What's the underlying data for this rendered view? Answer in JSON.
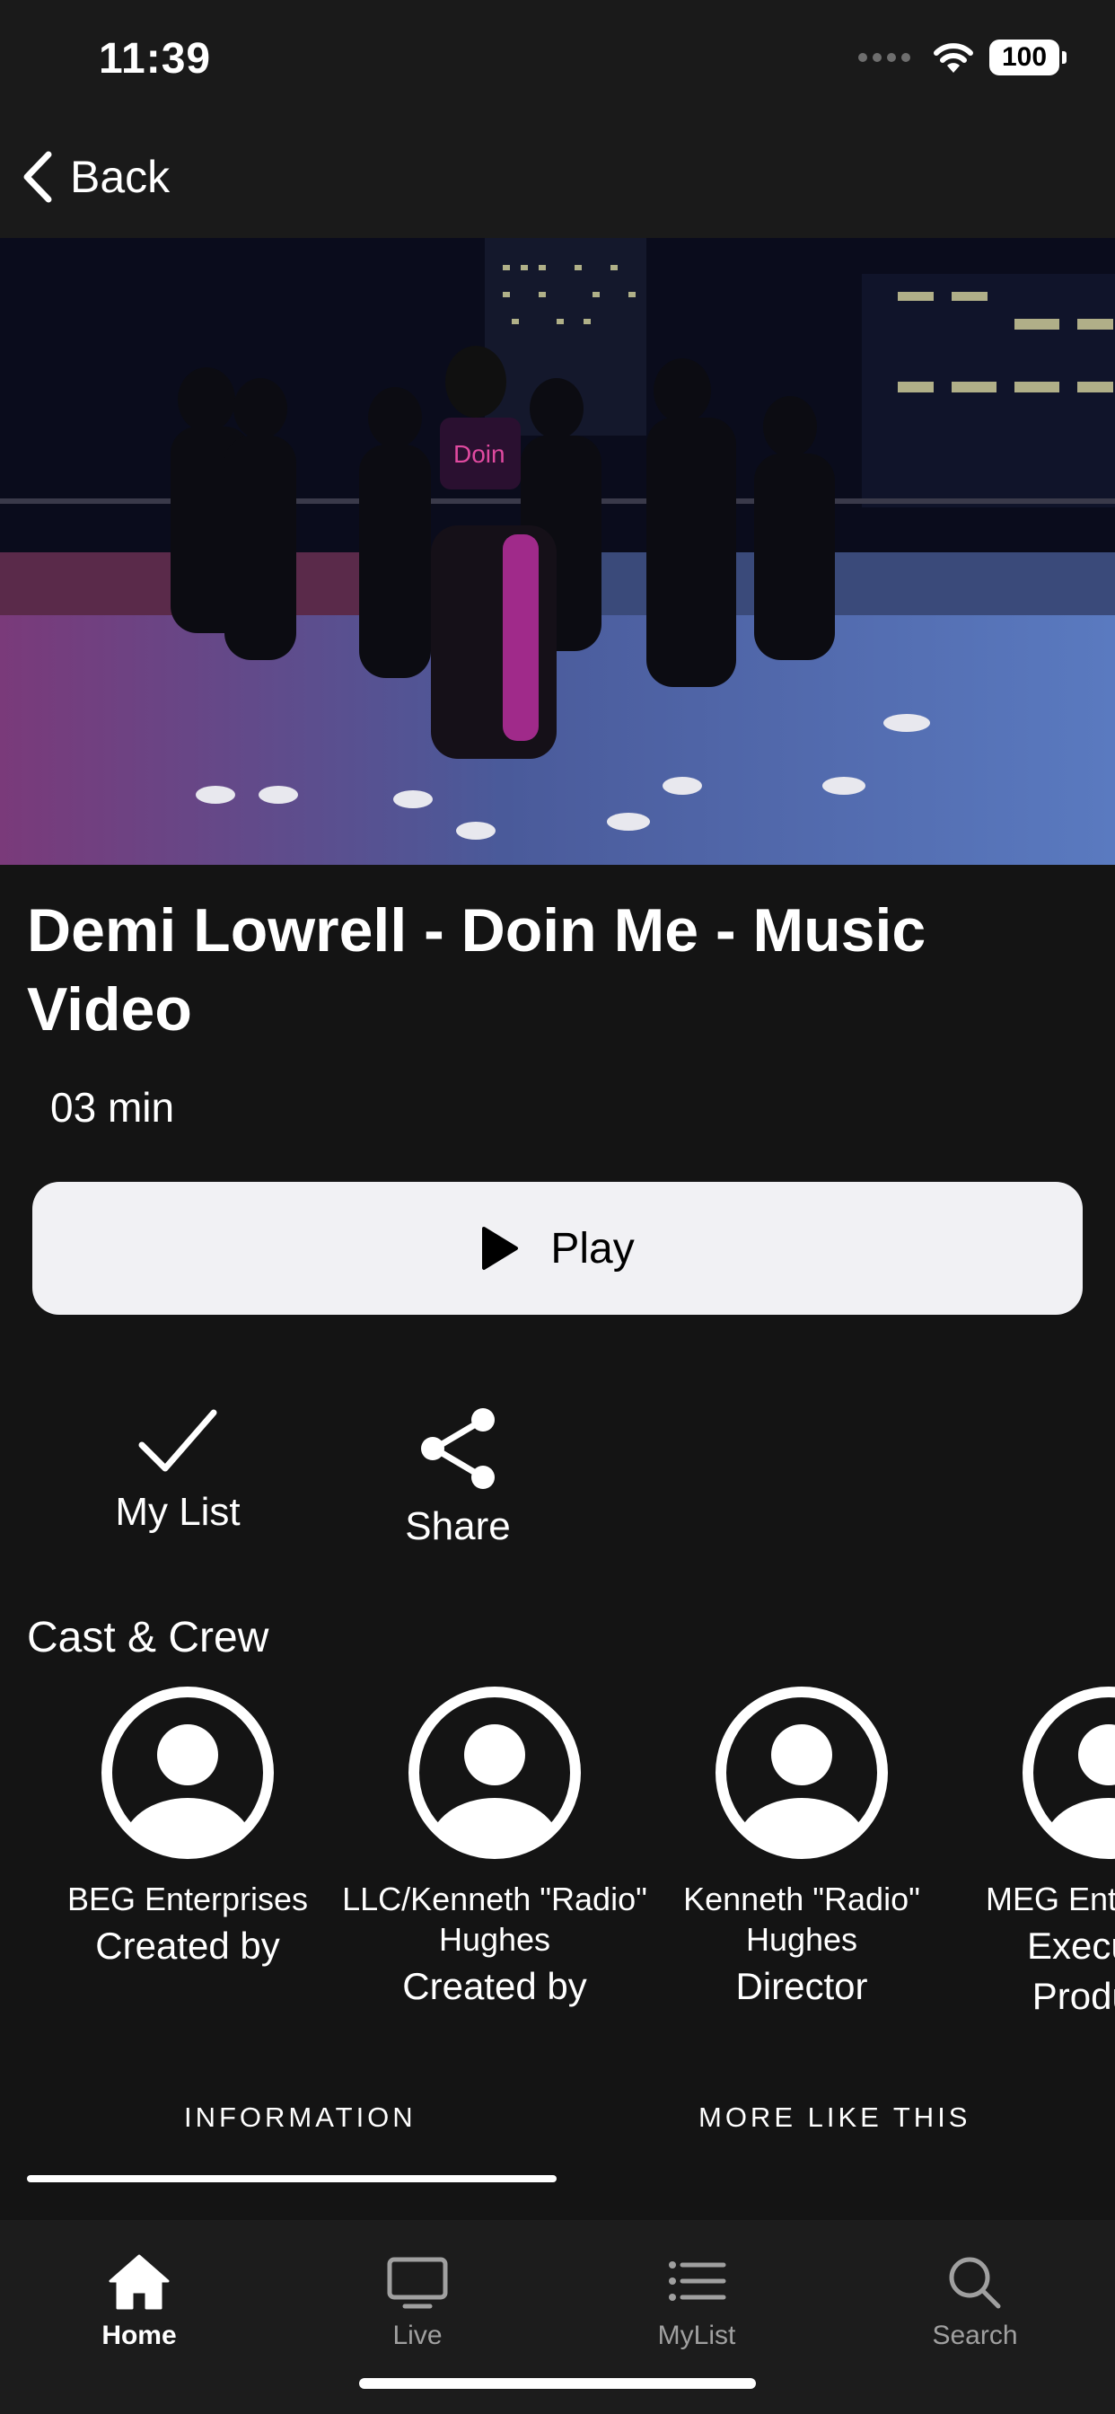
{
  "status": {
    "time": "11:39",
    "battery": "100"
  },
  "nav": {
    "back_label": "Back"
  },
  "video": {
    "title": "Demi Lowrell - Doin Me - Music Video",
    "duration": "03 min",
    "play_label": "Play"
  },
  "actions": {
    "my_list_label": "My List",
    "share_label": "Share"
  },
  "cast": {
    "section_title": "Cast & Crew",
    "members": [
      {
        "name": "BEG Enterprises",
        "role": "Created by"
      },
      {
        "name": "LLC/Kenneth \"Radio\" Hughes",
        "role": "Created by"
      },
      {
        "name": "Kenneth \"Radio\" Hughes",
        "role": "Director"
      },
      {
        "name": "MEG Enterprises",
        "role": "Executive Producer"
      }
    ]
  },
  "tabs": {
    "information": "INFORMATION",
    "more_like_this": "MORE LIKE THIS",
    "active": "INFORMATION"
  },
  "bottom_nav": [
    {
      "label": "Home",
      "icon": "home-icon",
      "active": true
    },
    {
      "label": "Live",
      "icon": "tv-icon",
      "active": false
    },
    {
      "label": "MyList",
      "icon": "list-icon",
      "active": false
    },
    {
      "label": "Search",
      "icon": "search-icon",
      "active": false
    }
  ],
  "colors": {
    "background": "#141414",
    "play_button": "#f1f1f4",
    "inactive_nav": "#a0a0a0"
  }
}
